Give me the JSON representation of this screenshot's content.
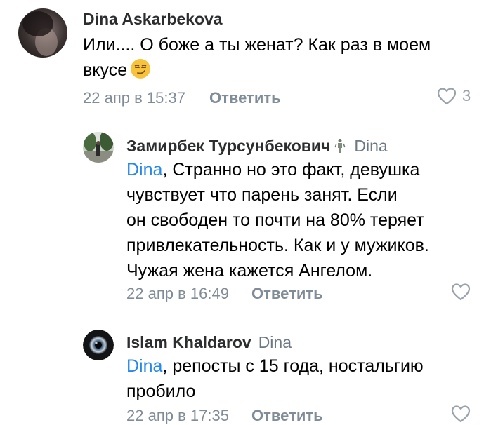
{
  "comments": [
    {
      "author": "Dina Askarbekova",
      "reply_to": "",
      "mention": "",
      "text_line1": "Или.... О боже а ты женат? Как раз в моем",
      "text_line2": "вкусе",
      "emoji": "smirking-face",
      "timestamp": "22 апр в 15:37",
      "reply_label": "Ответить",
      "likes": "3"
    },
    {
      "author": "Замирбек Турсунбекович",
      "author_badge": "person-standing-icon",
      "reply_to": "Dina",
      "mention": "Dina",
      "text_line1": ", Странно но это факт, девушка",
      "text_rest": [
        "чувствует что парень занят. Если",
        "он свободен то почти на 80% теряет",
        "привлекательность. Как и у мужиков.",
        "Чужая жена кажется Ангелом."
      ],
      "timestamp": "22 апр в 16:49",
      "reply_label": "Ответить",
      "likes": ""
    },
    {
      "author": "Islam Khaldarov",
      "reply_to": "Dina",
      "mention": "Dina",
      "text_line1": ", репосты с 15 года, ностальгию",
      "text_rest": [
        "пробило"
      ],
      "timestamp": "22 апр в 17:35",
      "reply_label": "Ответить",
      "likes": ""
    }
  ],
  "colors": {
    "accent": "#2688eb",
    "secondary": "#818c99",
    "like": "#99a2ad"
  }
}
